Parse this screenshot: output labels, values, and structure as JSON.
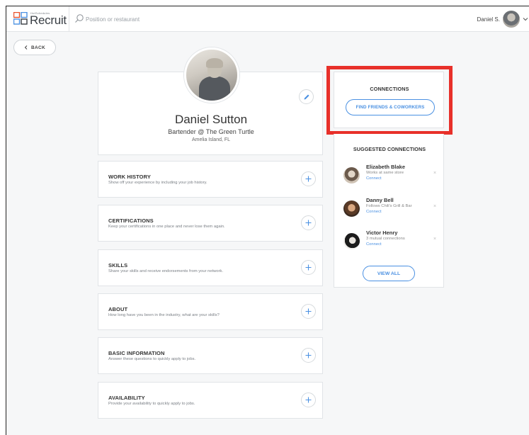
{
  "header": {
    "logo_small": "HotSchedules",
    "logo_text": "Recruit",
    "search_placeholder": "Position or restaurant",
    "user_name": "Daniel S."
  },
  "back_label": "BACK",
  "profile": {
    "name": "Daniel Sutton",
    "title": "Bartender @ The Green Turtle",
    "location": "Amelia Island, FL"
  },
  "sections": [
    {
      "title": "WORK HISTORY",
      "desc": "Show off your experience by including your job history."
    },
    {
      "title": "CERTIFICATIONS",
      "desc": "Keep your certifications in one place and never lose them again."
    },
    {
      "title": "SKILLS",
      "desc": "Share your skills and receive endorsements from your network."
    },
    {
      "title": "ABOUT",
      "desc": "How long have you been in the industry, what are your skills?"
    },
    {
      "title": "BASIC INFORMATION",
      "desc": "Answer these questions to quickly apply to jobs."
    },
    {
      "title": "AVAILABILITY",
      "desc": "Provide your availability to quickly apply to jobs."
    }
  ],
  "connections": {
    "title": "CONNECTIONS",
    "find_button": "FIND FRIENDS & COWORKERS"
  },
  "suggested": {
    "title": "SUGGESTED CONNECTIONS",
    "items": [
      {
        "name": "Elizabeth Blake",
        "sub": "Works at same store",
        "action": "Connect",
        "dismiss": "×"
      },
      {
        "name": "Danny Bell",
        "sub": "Follows Chili's Grill & Bar",
        "action": "Connect",
        "dismiss": "×"
      },
      {
        "name": "Victor Henry",
        "sub": "3 mutual connections",
        "action": "Connect",
        "dismiss": "×"
      }
    ],
    "view_all": "VIEW ALL"
  },
  "colors": {
    "accent": "#4a90e2",
    "highlight": "#e8302a",
    "background": "#f6f7f8"
  }
}
